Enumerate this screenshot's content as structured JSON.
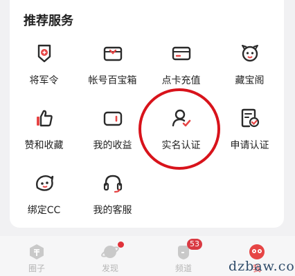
{
  "section": {
    "title": "推荐服务"
  },
  "services": [
    {
      "label": "将军令",
      "icon": "shield-token-icon"
    },
    {
      "label": "帐号百宝箱",
      "icon": "treasure-box-icon"
    },
    {
      "label": "点卡充值",
      "icon": "card-icon"
    },
    {
      "label": "藏宝阁",
      "icon": "mascot-icon"
    },
    {
      "label": "赞和收藏",
      "icon": "thumbs-up-icon"
    },
    {
      "label": "我的收益",
      "icon": "wallet-icon"
    },
    {
      "label": "实名认证",
      "icon": "user-verified-icon"
    },
    {
      "label": "申请认证",
      "icon": "document-check-icon"
    },
    {
      "label": "绑定CC",
      "icon": "cc-mascot-icon"
    },
    {
      "label": "我的客服",
      "icon": "headset-icon"
    }
  ],
  "tabs": [
    {
      "label": "圈子",
      "icon": "circle-hex-icon",
      "active": false
    },
    {
      "label": "发现",
      "icon": "planet-icon",
      "active": false,
      "dot": true
    },
    {
      "label": "频道",
      "icon": "channel-icon",
      "active": false,
      "badge": "53"
    },
    {
      "label": "我",
      "icon": "profile-mask-icon",
      "active": true
    }
  ],
  "watermark": "dzbaw.com",
  "colors": {
    "accent": "#e64545",
    "annotation": "#d8131b",
    "icon_stroke": "#2a2a2a"
  }
}
